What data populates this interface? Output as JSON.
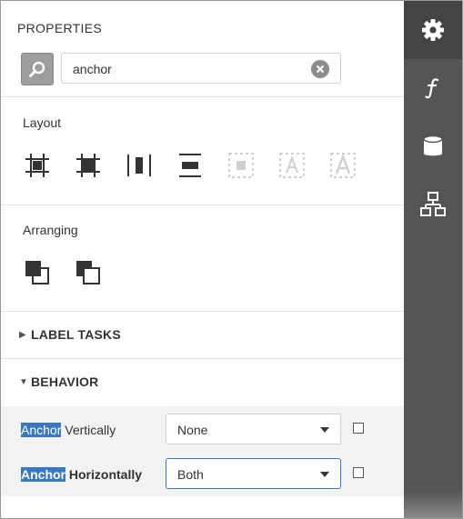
{
  "panel": {
    "title": "PROPERTIES",
    "search": {
      "value": "anchor",
      "placeholder": ""
    }
  },
  "layout": {
    "label": "Layout",
    "tools": [
      {
        "icon": "center-grid-icon",
        "enabled": true
      },
      {
        "icon": "fit-grid-icon",
        "enabled": true
      },
      {
        "icon": "distribute-columns-icon",
        "enabled": true
      },
      {
        "icon": "distribute-rows-icon",
        "enabled": true
      },
      {
        "icon": "fit-bounds-icon",
        "enabled": false
      },
      {
        "icon": "fit-text-icon",
        "enabled": false
      },
      {
        "icon": "size-to-text-icon",
        "enabled": false
      }
    ]
  },
  "arranging": {
    "label": "Arranging",
    "tools": [
      {
        "icon": "bring-to-front-icon"
      },
      {
        "icon": "send-to-back-icon"
      }
    ]
  },
  "groups": {
    "label_tasks": "LABEL TASKS",
    "behavior": "BEHAVIOR"
  },
  "properties": [
    {
      "label_highlight": "Anchor",
      "label_rest": " Vertically",
      "bold": false,
      "value": "None",
      "focused": false
    },
    {
      "label_highlight": "Anchor",
      "label_rest": " Horizontally",
      "bold": true,
      "value": "Both",
      "focused": true
    }
  ],
  "sidebar": {
    "tabs": [
      "properties-gear-icon",
      "expressions-function-icon",
      "data-source-database-icon",
      "report-explorer-hierarchy-icon"
    ],
    "active": 0
  },
  "colors": {
    "sidebar": "#555555",
    "sidebar_active": "#444444",
    "highlight": "#3a77c2",
    "props_background": "#f2f2f2"
  }
}
